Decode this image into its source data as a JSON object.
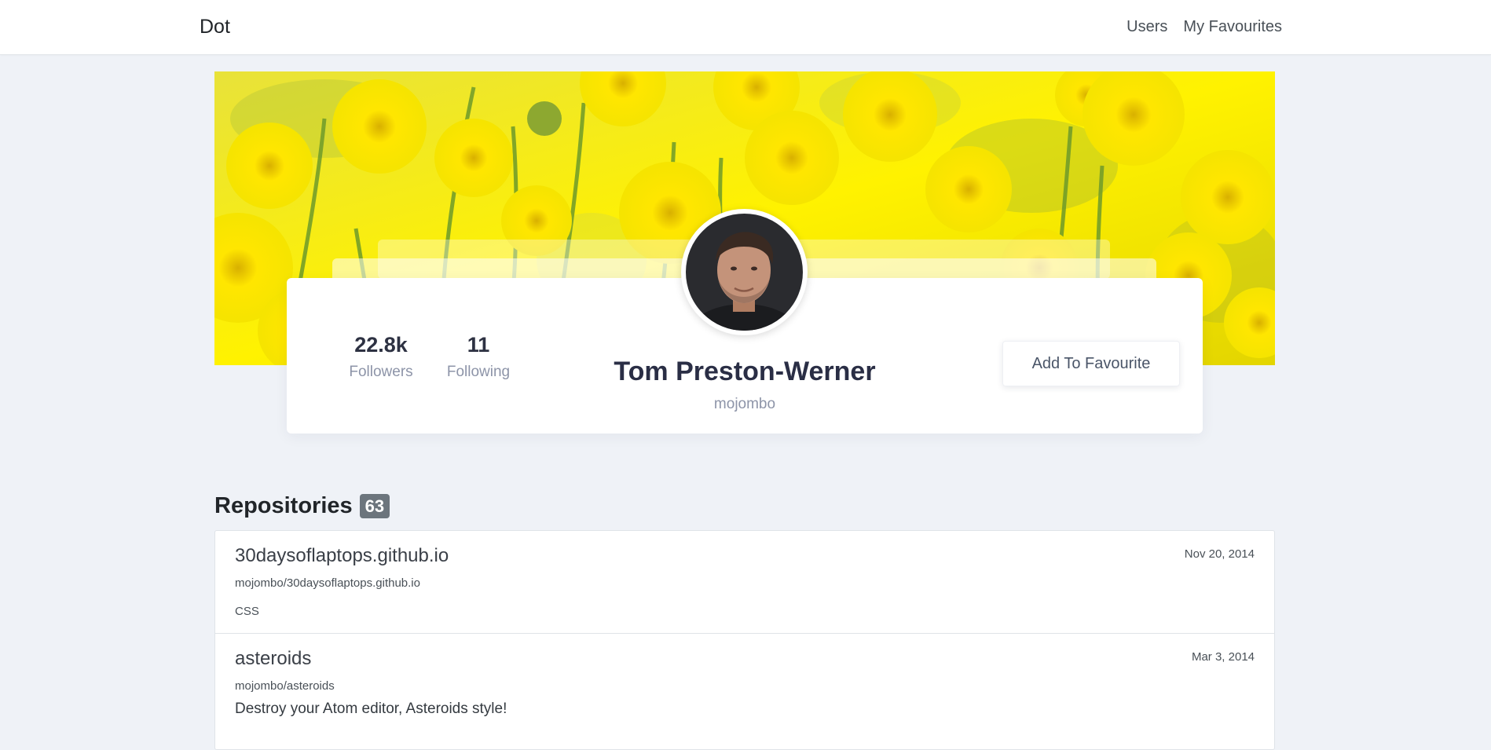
{
  "navbar": {
    "brand": "Dot",
    "links": [
      "Users",
      "My Favourites"
    ]
  },
  "profile": {
    "followers_value": "22.8k",
    "followers_label": "Followers",
    "following_value": "11",
    "following_label": "Following",
    "name": "Tom Preston-Werner",
    "login": "mojombo",
    "favourite_button": "Add To Favourite"
  },
  "repositories": {
    "title": "Repositories",
    "count": "63",
    "items": [
      {
        "name": "30daysoflaptops.github.io",
        "full_name": "mojombo/30daysoflaptops.github.io",
        "language": "CSS",
        "description": "",
        "date": "Nov 20, 2014"
      },
      {
        "name": "asteroids",
        "full_name": "mojombo/asteroids",
        "language": "",
        "description": "Destroy your Atom editor, Asteroids style!",
        "date": "Mar 3, 2014"
      }
    ]
  },
  "colors": {
    "page_background": "#eff2f7",
    "badge": "#6c757d",
    "cover_yellow": "#f2e300"
  },
  "icons": [
    "cover-image",
    "avatar-image"
  ]
}
